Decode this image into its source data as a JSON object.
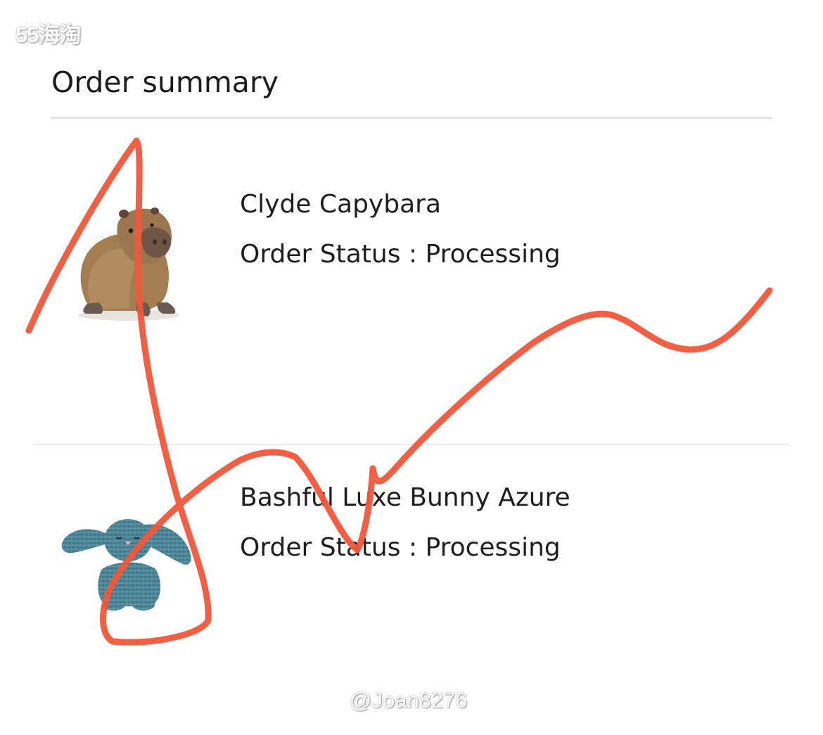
{
  "watermark": {
    "top": "55海淘",
    "bottom": "@Joan8276"
  },
  "page": {
    "title": "Order summary"
  },
  "order_items": [
    {
      "name": "Clyde Capybara",
      "status_label": "Order Status :",
      "status_value": "Processing",
      "image": "capybara-plush"
    },
    {
      "name": "Bashful Luxe Bunny Azure",
      "status_label": "Order Status :",
      "status_value": "Processing",
      "image": "bunny-plush"
    }
  ],
  "colors": {
    "annotation_stroke": "#f0573a",
    "divider": "#e4e4e4",
    "text": "#1e1e1e",
    "capybara_fur": "#a07b52",
    "bunny_fur": "#4f8797"
  }
}
